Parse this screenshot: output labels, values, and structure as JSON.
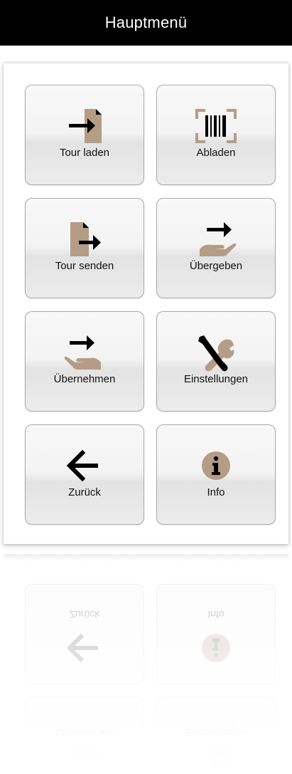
{
  "header": {
    "title": "Hauptmenü"
  },
  "colors": {
    "header_bg": "#000000",
    "accent": "#b49c86",
    "icon": "#000000"
  },
  "menu": [
    {
      "label": "Tour laden",
      "icon": "document-import-icon"
    },
    {
      "label": "Abladen",
      "icon": "barcode-scan-icon"
    },
    {
      "label": "Tour senden",
      "icon": "document-export-icon"
    },
    {
      "label": "Übergeben",
      "icon": "hand-give-icon"
    },
    {
      "label": "Übernehmen",
      "icon": "hand-receive-icon"
    },
    {
      "label": "Einstellungen",
      "icon": "tools-icon"
    },
    {
      "label": "Zurück",
      "icon": "arrow-left-icon"
    },
    {
      "label": "Info",
      "icon": "info-icon"
    }
  ]
}
